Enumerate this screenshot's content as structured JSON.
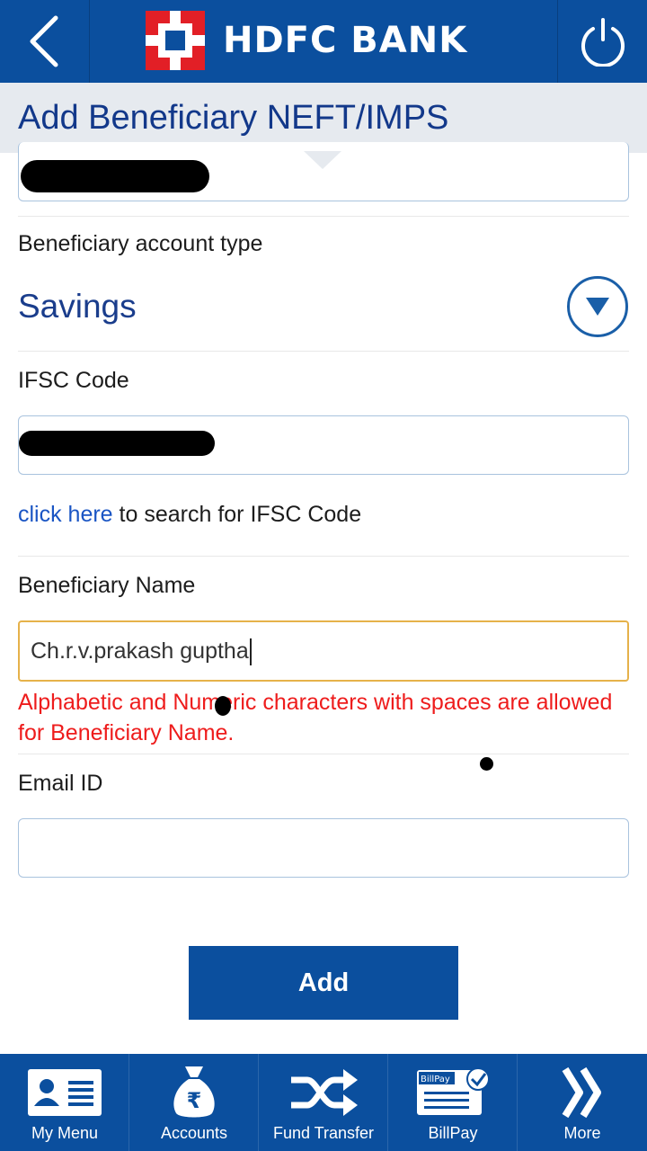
{
  "header": {
    "brand_name": "HDFC BANK",
    "back_icon": "chevron-left-icon",
    "power_icon": "power-icon",
    "color": "#0b4f9e"
  },
  "page": {
    "title": "Add Beneficiary NEFT/IMPS"
  },
  "form": {
    "account_type_label": "Beneficiary account type",
    "account_type_value": "Savings",
    "ifsc_label": "IFSC Code",
    "ifsc_search_link": "click here",
    "ifsc_search_text": " to search for IFSC Code",
    "name_label": "Beneficiary Name",
    "name_value": "Ch.r.v.prakash guptha",
    "name_error": "Alphabetic and Numeric characters with spaces are allowed for Beneficiary Name.",
    "email_label": "Email ID",
    "email_value": "",
    "add_button": "Add"
  },
  "bottom_nav": [
    {
      "label": "My Menu",
      "icon": "contact-card-icon"
    },
    {
      "label": "Accounts",
      "icon": "money-bag-icon"
    },
    {
      "label": "Fund Transfer",
      "icon": "shuffle-icon"
    },
    {
      "label": "BillPay",
      "icon": "billpay-icon"
    },
    {
      "label": "More",
      "icon": "double-chevron-right-icon"
    }
  ]
}
